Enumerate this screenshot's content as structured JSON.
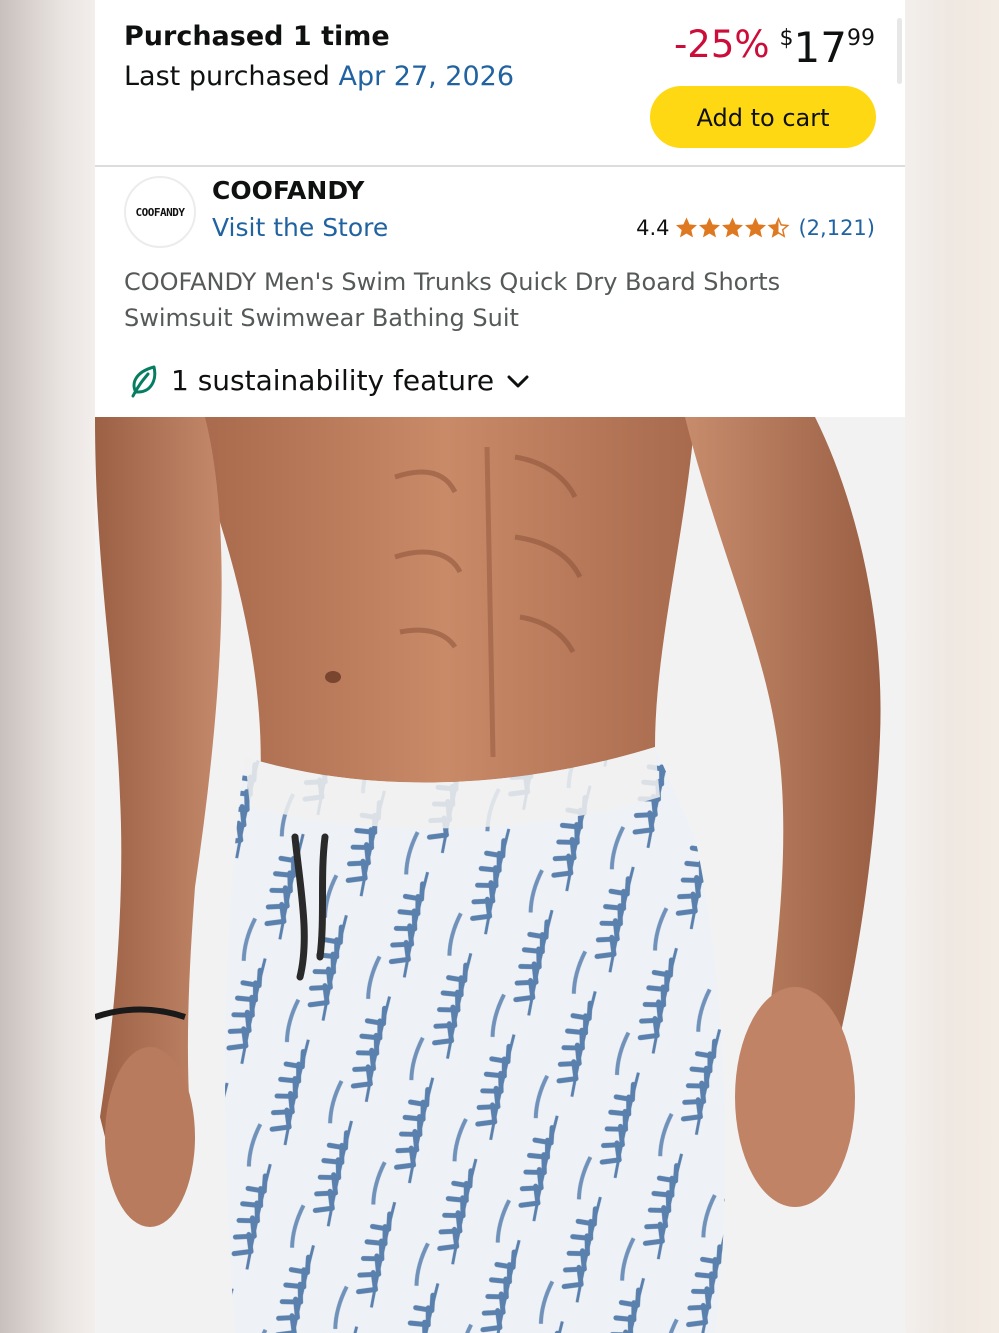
{
  "purchase": {
    "count_label": "Purchased 1 time",
    "last_prefix": "Last purchased ",
    "last_date": "Apr 27, 2026"
  },
  "price": {
    "discount": "-25%",
    "currency": "$",
    "whole": "17",
    "fraction": "99"
  },
  "add_to_cart_label": "Add to cart",
  "brand": {
    "logo_text": "COOFANDY",
    "name": "COOFANDY",
    "store_link": "Visit the Store"
  },
  "rating": {
    "value": "4.4",
    "stars": 4.4,
    "reviews": "(2,121)"
  },
  "product": {
    "title": "COOFANDY Men's Swim Trunks Quick Dry Board Shorts Swimsuit Swimwear Bathing Suit"
  },
  "sustainability": {
    "label": "1 sustainability feature"
  },
  "colors": {
    "cart_button": "#ffd814",
    "discount": "#cc0c39",
    "link": "#2162a1",
    "star": "#de7921",
    "leaf": "#067d62",
    "shorts_print": "#5a80ad"
  },
  "icons": {
    "star": "star-icon",
    "leaf": "leaf-icon",
    "chevron": "chevron-down-icon"
  }
}
